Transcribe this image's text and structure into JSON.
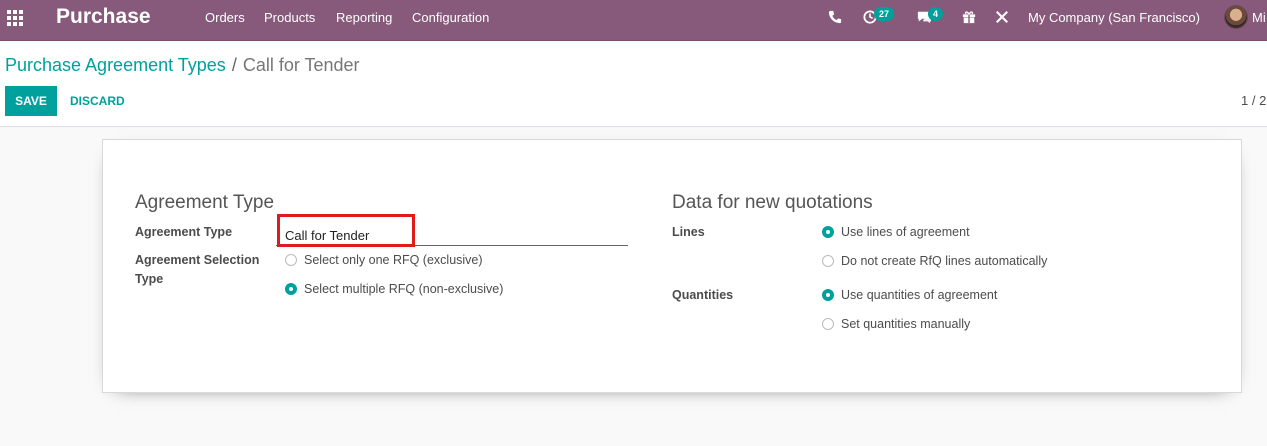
{
  "navbar": {
    "app_name": "Purchase",
    "menu": [
      "Orders",
      "Products",
      "Reporting",
      "Configuration"
    ],
    "activity_count": "27",
    "message_count": "4",
    "company": "My Company (San Francisco)",
    "user_partial": "Mi"
  },
  "breadcrumb": {
    "parent": "Purchase Agreement Types",
    "separator": "/",
    "current": "Call for Tender"
  },
  "actions": {
    "save": "Save",
    "discard": "Discard"
  },
  "pager": "1 / 2",
  "form": {
    "left_group": {
      "title": "Agreement Type",
      "agreement_type_label": "Agreement Type",
      "agreement_type_value": "Call for Tender",
      "selection_type_label_1": "Agreement Selection",
      "selection_type_label_2": "Type",
      "selection_options": [
        {
          "label": "Select only one RFQ (exclusive)",
          "checked": false
        },
        {
          "label": "Select multiple RFQ (non-exclusive)",
          "checked": true
        }
      ]
    },
    "right_group": {
      "title": "Data for new quotations",
      "lines_label": "Lines",
      "lines_options": [
        {
          "label": "Use lines of agreement",
          "checked": true
        },
        {
          "label": "Do not create RfQ lines automatically",
          "checked": false
        }
      ],
      "quantities_label": "Quantities",
      "quantities_options": [
        {
          "label": "Use quantities of agreement",
          "checked": true
        },
        {
          "label": "Set quantities manually",
          "checked": false
        }
      ]
    }
  },
  "colors": {
    "brand": "#875a7b",
    "accent": "#00a09d",
    "highlight": "#e01b1b"
  }
}
